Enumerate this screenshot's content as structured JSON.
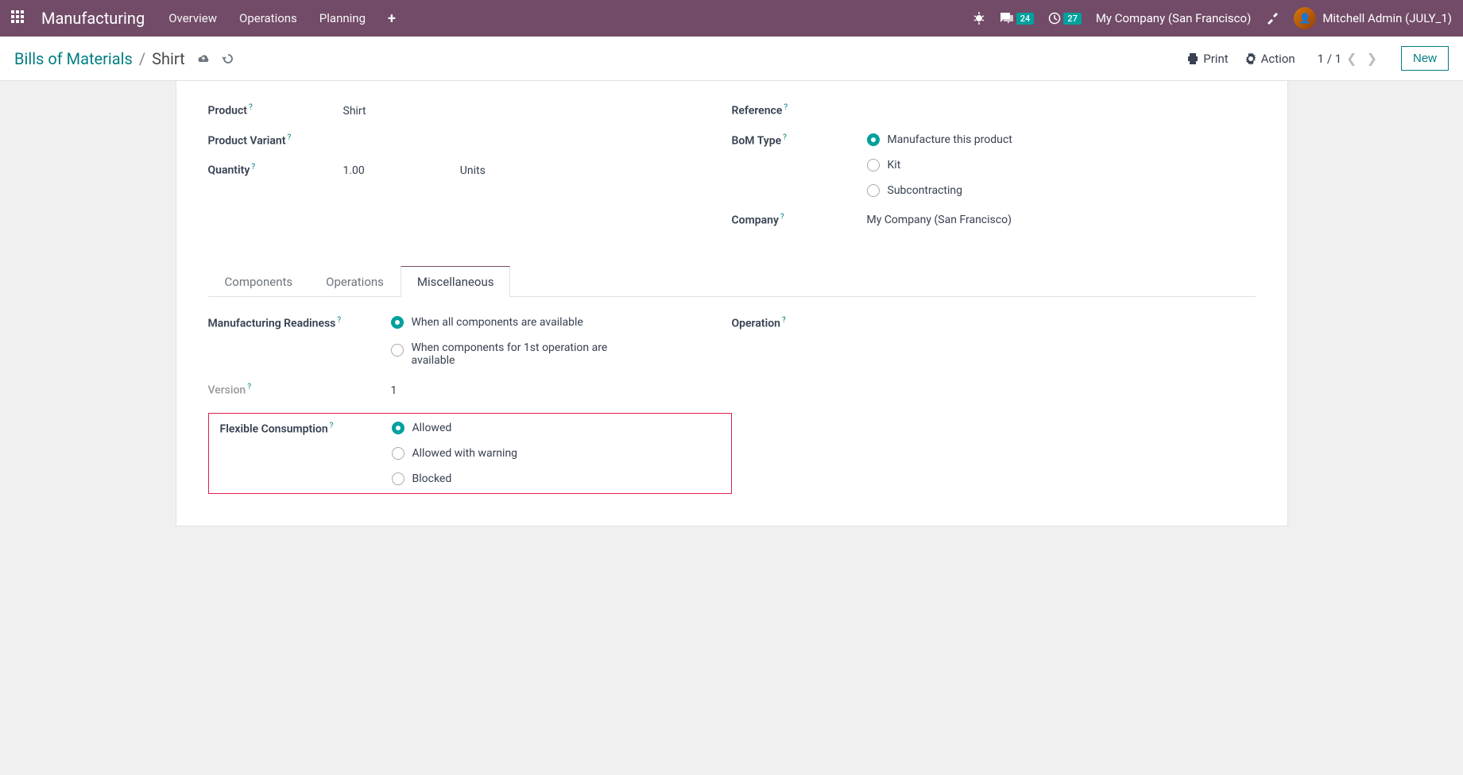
{
  "topbar": {
    "app_title": "Manufacturing",
    "nav": [
      "Overview",
      "Operations",
      "Planning"
    ],
    "msg_badge": "24",
    "activity_badge": "27",
    "company": "My Company (San Francisco)",
    "user": "Mitchell Admin (JULY_1)"
  },
  "control_panel": {
    "breadcrumb_root": "Bills of Materials",
    "breadcrumb_current": "Shirt",
    "print_label": "Print",
    "action_label": "Action",
    "pager": "1 / 1",
    "new_label": "New"
  },
  "form": {
    "left": {
      "product_label": "Product",
      "product_value": "Shirt",
      "variant_label": "Product Variant",
      "variant_value": "",
      "qty_label": "Quantity",
      "qty_value": "1.00",
      "qty_unit": "Units"
    },
    "right": {
      "reference_label": "Reference",
      "reference_value": "",
      "bom_type_label": "BoM Type",
      "bom_options": [
        "Manufacture this product",
        "Kit",
        "Subcontracting"
      ],
      "company_label": "Company",
      "company_value": "My Company (San Francisco)"
    }
  },
  "tabs": [
    "Components",
    "Operations",
    "Miscellaneous"
  ],
  "misc": {
    "readiness_label": "Manufacturing Readiness",
    "readiness_options": [
      "When all components are available",
      "When components for 1st operation are available"
    ],
    "version_label": "Version",
    "version_value": "1",
    "flex_label": "Flexible Consumption",
    "flex_options": [
      "Allowed",
      "Allowed with warning",
      "Blocked"
    ],
    "operation_label": "Operation",
    "operation_value": ""
  }
}
